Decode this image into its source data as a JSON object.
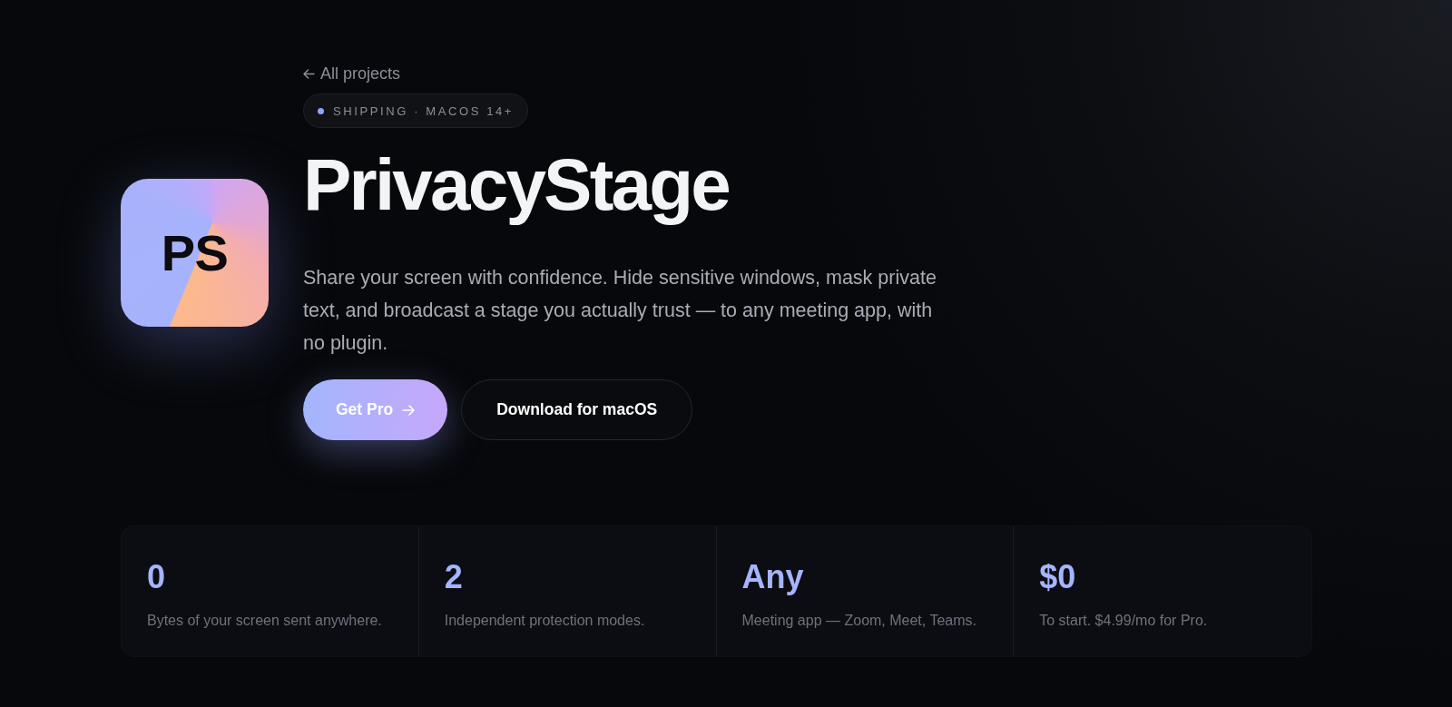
{
  "back_link": {
    "label": "All projects"
  },
  "status_badge": {
    "label": "SHIPPING · MACOS 14+"
  },
  "app_logo": {
    "label": "PS"
  },
  "title": "PrivacyStage",
  "description": "Share your screen with confidence. Hide sensitive windows, mask private text, and broadcast a stage you actually trust — to any meeting app, with no plugin.",
  "buttons": [
    {
      "label": "Get Pro",
      "kind": "primary"
    },
    {
      "label": "Download for macOS",
      "kind": "secondary"
    }
  ],
  "stats": [
    {
      "value": "0",
      "label": "Bytes of your screen sent anywhere."
    },
    {
      "value": "2",
      "label": "Independent protection modes."
    },
    {
      "value": "Any",
      "label": "Meeting app — Zoom, Meet, Teams."
    },
    {
      "value": "$0",
      "label": "To start. $4.99/mo for Pro."
    }
  ]
}
